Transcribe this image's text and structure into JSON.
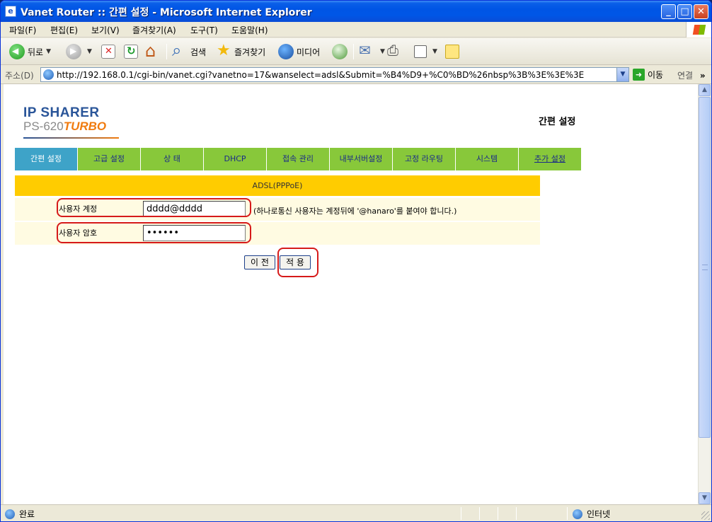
{
  "window": {
    "title": "Vanet Router :: 간편 설정 - Microsoft Internet Explorer",
    "min_symbol": "_",
    "max_symbol": "□",
    "close_symbol": "✕",
    "favicon": "e"
  },
  "menu": {
    "items": [
      "파일(F)",
      "편집(E)",
      "보기(V)",
      "즐겨찾기(A)",
      "도구(T)",
      "도움말(H)"
    ]
  },
  "toolbar": {
    "back_label": "뒤로",
    "search_label": "검색",
    "favorites_label": "즐겨찾기",
    "media_label": "미디어"
  },
  "address": {
    "label": "주소(D)",
    "url": "http://192.168.0.1/cgi-bin/vanet.cgi?vanetno=17&wanselect=adsl&Submit=%B4%D9+%C0%BD%26nbsp%3B%3E%3E%3E",
    "go_label": "이동",
    "links_label": "연결",
    "links_arrow": "»"
  },
  "page": {
    "logo_main": "IP SHARER",
    "logo_model": "PS-620",
    "logo_turbo": "TURBO",
    "heading": "간편 설정",
    "nav": [
      {
        "label": "간편 설정",
        "active": true
      },
      {
        "label": "고급 설정"
      },
      {
        "label": "상 태"
      },
      {
        "label": "DHCP"
      },
      {
        "label": "접속 관리"
      },
      {
        "label": "내부서버설정"
      },
      {
        "label": "고정 라우팅"
      },
      {
        "label": "시스템"
      },
      {
        "label": "추가 설정",
        "link": true
      }
    ],
    "section_title": "ADSL(PPPoE)",
    "form": {
      "user_label": "사용자 계정",
      "user_value": "dddd@dddd",
      "user_note": "(하나로통신 사용자는 계정뒤에 '@hanaro'를 붙여야 합니다.)",
      "password_label": "사용자 암호",
      "password_value": "••••••"
    },
    "buttons": {
      "prev": "이 전",
      "apply": "적 용"
    }
  },
  "status": {
    "left_text": "완료",
    "zone_text": "인터넷"
  },
  "colors": {
    "nav_green": "#88c83a",
    "nav_active": "#3ea3c8",
    "section_yellow": "#ffcc00",
    "annotation_red": "#d61a1a"
  }
}
